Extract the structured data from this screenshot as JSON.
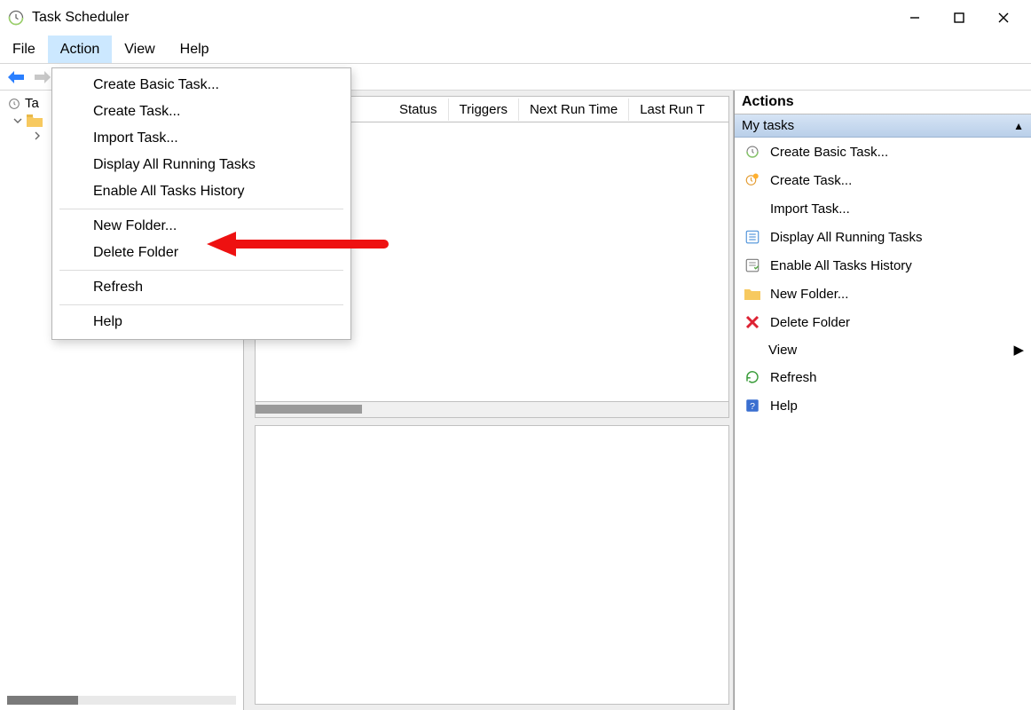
{
  "window": {
    "title": "Task Scheduler"
  },
  "menubar": {
    "items": [
      "File",
      "Action",
      "View",
      "Help"
    ],
    "active_index": 1
  },
  "dropdown": {
    "groups": [
      [
        "Create Basic Task...",
        "Create Task...",
        "Import Task...",
        "Display All Running Tasks",
        "Enable All Tasks History"
      ],
      [
        "New Folder...",
        "Delete Folder"
      ],
      [
        "Refresh"
      ],
      [
        "Help"
      ]
    ]
  },
  "tree": {
    "root": "Ta"
  },
  "table": {
    "columns": [
      "Status",
      "Triggers",
      "Next Run Time",
      "Last Run T"
    ]
  },
  "actions": {
    "pane_title": "Actions",
    "group": "My tasks",
    "items": [
      {
        "icon": "clock",
        "label": "Create Basic Task..."
      },
      {
        "icon": "clock-orange",
        "label": "Create Task..."
      },
      {
        "icon": "none",
        "label": "Import Task..."
      },
      {
        "icon": "list",
        "label": "Display All Running Tasks"
      },
      {
        "icon": "list-check",
        "label": "Enable All Tasks History"
      },
      {
        "icon": "folder",
        "label": "New Folder..."
      },
      {
        "icon": "delete",
        "label": "Delete Folder"
      },
      {
        "icon": "chevron",
        "label": "View"
      },
      {
        "icon": "refresh",
        "label": "Refresh"
      },
      {
        "icon": "help",
        "label": "Help"
      }
    ]
  }
}
